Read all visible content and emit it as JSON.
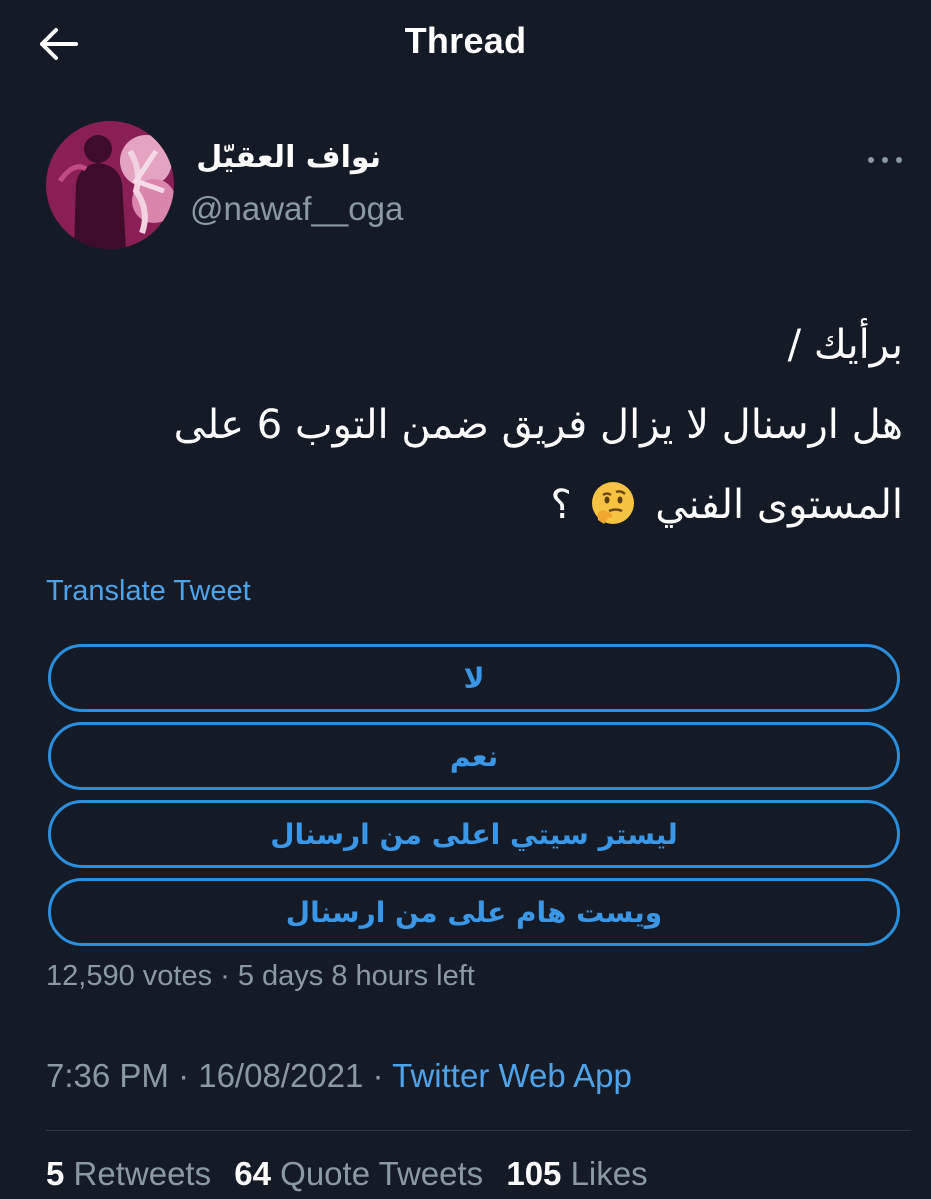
{
  "header": {
    "title": "Thread"
  },
  "tweet": {
    "display_name": "نواف العقيّل",
    "handle": "@nawaf__oga",
    "text_lines": [
      "برأيك /",
      "هل ارسنال لا يزال فريق ضمن التوب 6 على",
      "المستوى الفني",
      "؟"
    ],
    "emoji": "thinking-face-emoji",
    "translate_label": "Translate Tweet",
    "poll": {
      "options": [
        "لا",
        "نعم",
        "ليستر سيتي اعلى من ارسنال",
        "ويست هام على من ارسنال"
      ],
      "meta": "12,590 votes · 5 days 8 hours left"
    },
    "time": "7:36 PM · 16/08/2021 · ",
    "source": "Twitter Web App",
    "stats": {
      "retweets_count": "5",
      "retweets_label": "Retweets",
      "quotes_count": "64",
      "quotes_label": "Quote Tweets",
      "likes_count": "105",
      "likes_label": "Likes"
    }
  },
  "colors": {
    "background": "#151b26",
    "accent": "#4fa3ea",
    "secondary_text": "#8b98a5"
  }
}
